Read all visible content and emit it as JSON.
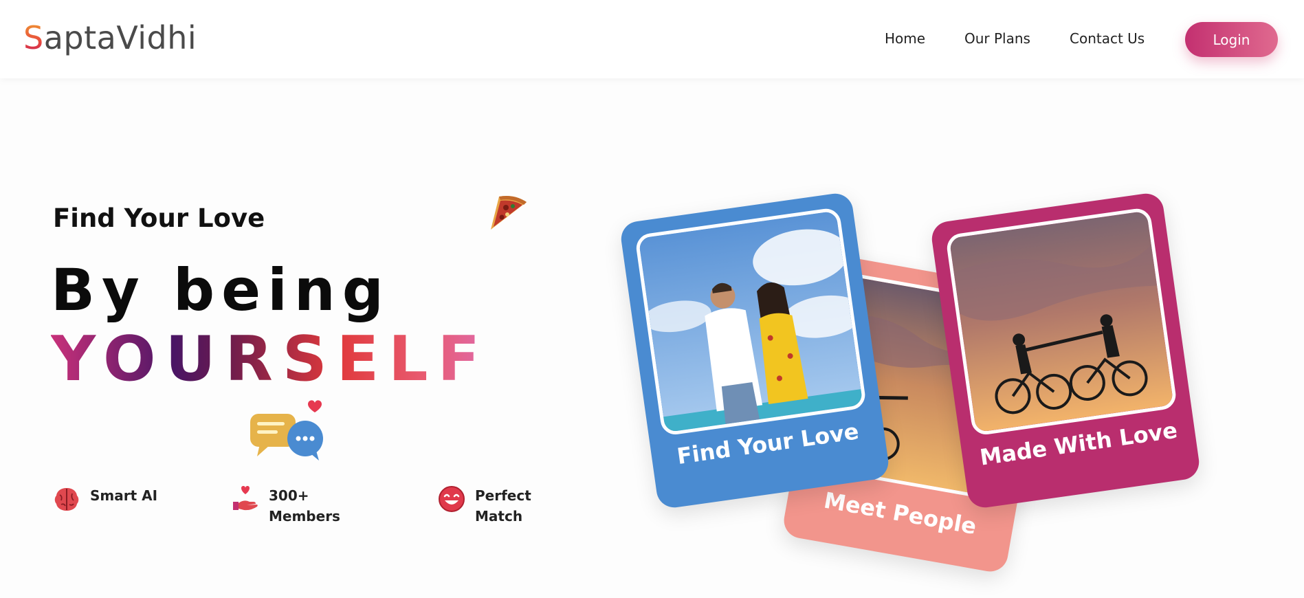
{
  "header": {
    "logo_first": "S",
    "logo_rest": "aptaVidhi",
    "nav": [
      {
        "label": "Home"
      },
      {
        "label": "Our Plans"
      },
      {
        "label": "Contact Us"
      }
    ],
    "login_label": "Login"
  },
  "hero": {
    "subtitle": "Find Your Love",
    "headline_line1": "By being",
    "headline_line2": "YOURSELF"
  },
  "features": [
    {
      "icon": "brain-icon",
      "label": "Smart AI"
    },
    {
      "icon": "heart-hand-icon",
      "label": "300+ Members"
    },
    {
      "icon": "smile-icon",
      "label": "Perfect Match"
    }
  ],
  "cards": [
    {
      "label": "Find Your Love",
      "color": "#4a8bd1",
      "icon": "couple-beach-photo"
    },
    {
      "label": "Meet People",
      "color": "#f2958c",
      "icon": "cyclists-sunset-photo"
    },
    {
      "label": "Made With Love",
      "color": "#b92e6e",
      "icon": "cyclists-sunset-photo"
    }
  ],
  "colors": {
    "brand_pink": "#c33070",
    "brand_blue": "#4a8bd1",
    "brand_peach": "#f2958c",
    "brand_magenta": "#b92e6e"
  }
}
